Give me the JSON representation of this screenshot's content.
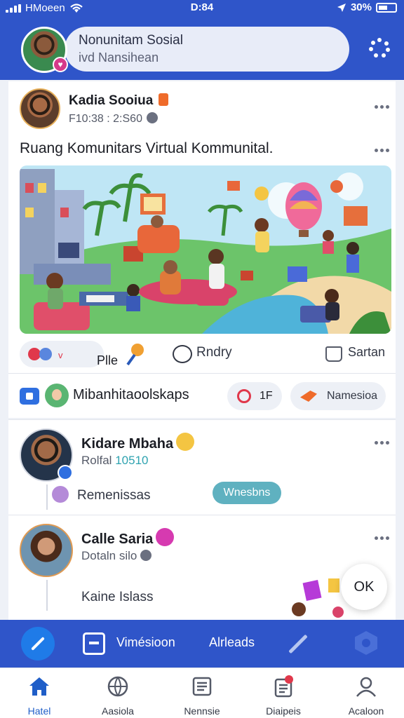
{
  "status": {
    "carrier": "HMoeen",
    "time": "D:84",
    "battery": "30%"
  },
  "header": {
    "title": "Nonunitam Sosial",
    "subtitle": "ivd Nansihean"
  },
  "post": {
    "author": "Kadia Sooiua",
    "timestamp": "F10:38 : 2:S60",
    "text": "Ruang Komunitars Virtual Kommunital.",
    "reaction_label": "Plle",
    "reply_label": "Rndry",
    "share_label": "Sartan"
  },
  "community": {
    "name": "Mibanhitaoolskaps",
    "count": "1F",
    "tag": "Namesioa"
  },
  "comments": [
    {
      "name": "Kidare Mbaha",
      "sub_prefix": "Rolfal",
      "sub_accent": "10510",
      "body": "Remenissas",
      "chip": "Wnesbns"
    },
    {
      "name": "Calle Saria",
      "sub": "Dotaln silo",
      "body": "Kaine Islass"
    }
  ],
  "fab": {
    "label": "OK"
  },
  "actionbar": {
    "label1": "Vimésioon",
    "label2": "Alrleads"
  },
  "nav": [
    {
      "label": "Hatel",
      "icon": "home-icon",
      "active": true
    },
    {
      "label": "Aasiola",
      "icon": "globe-icon"
    },
    {
      "label": "Nennsie",
      "icon": "document-icon"
    },
    {
      "label": "Diaipeis",
      "icon": "clipboard-icon",
      "badge": "1"
    },
    {
      "label": "Acaloon",
      "icon": "profile-icon"
    }
  ],
  "colors": {
    "brand": "#2f55c9",
    "accent_teal": "#5fb1c0",
    "alert": "#e0384b"
  }
}
